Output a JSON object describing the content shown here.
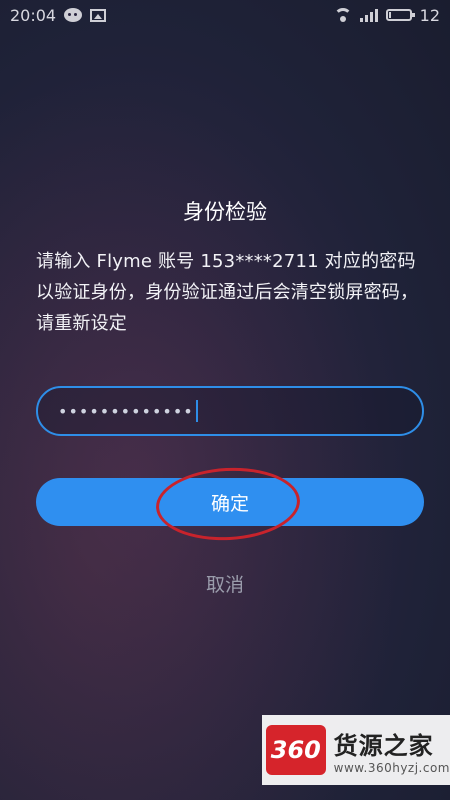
{
  "status_bar": {
    "time": "20:04",
    "battery_percent": "12",
    "network_type": "4G",
    "left_icons": [
      "wechat-icon",
      "image-icon"
    ],
    "right_icons": [
      "wifi-icon",
      "signal-icon",
      "battery-icon"
    ],
    "battery_level": 0.12
  },
  "dialog": {
    "title": "身份检验",
    "message": "请输入 Flyme 账号 153****2711 对应的密码以验证身份，身份验证通过后会清空锁屏密码，请重新设定",
    "password_value": "•••••••••••••",
    "confirm_label": "确定",
    "cancel_label": "取消"
  },
  "watermark": {
    "badge": "360",
    "name": "货源之家",
    "url": "www.360hyzj.com"
  },
  "colors": {
    "accent": "#2f8ff0",
    "highlight_ring": "#c8232c",
    "cancel_text": "#9a9cab",
    "watermark_badge": "#d6242b"
  }
}
